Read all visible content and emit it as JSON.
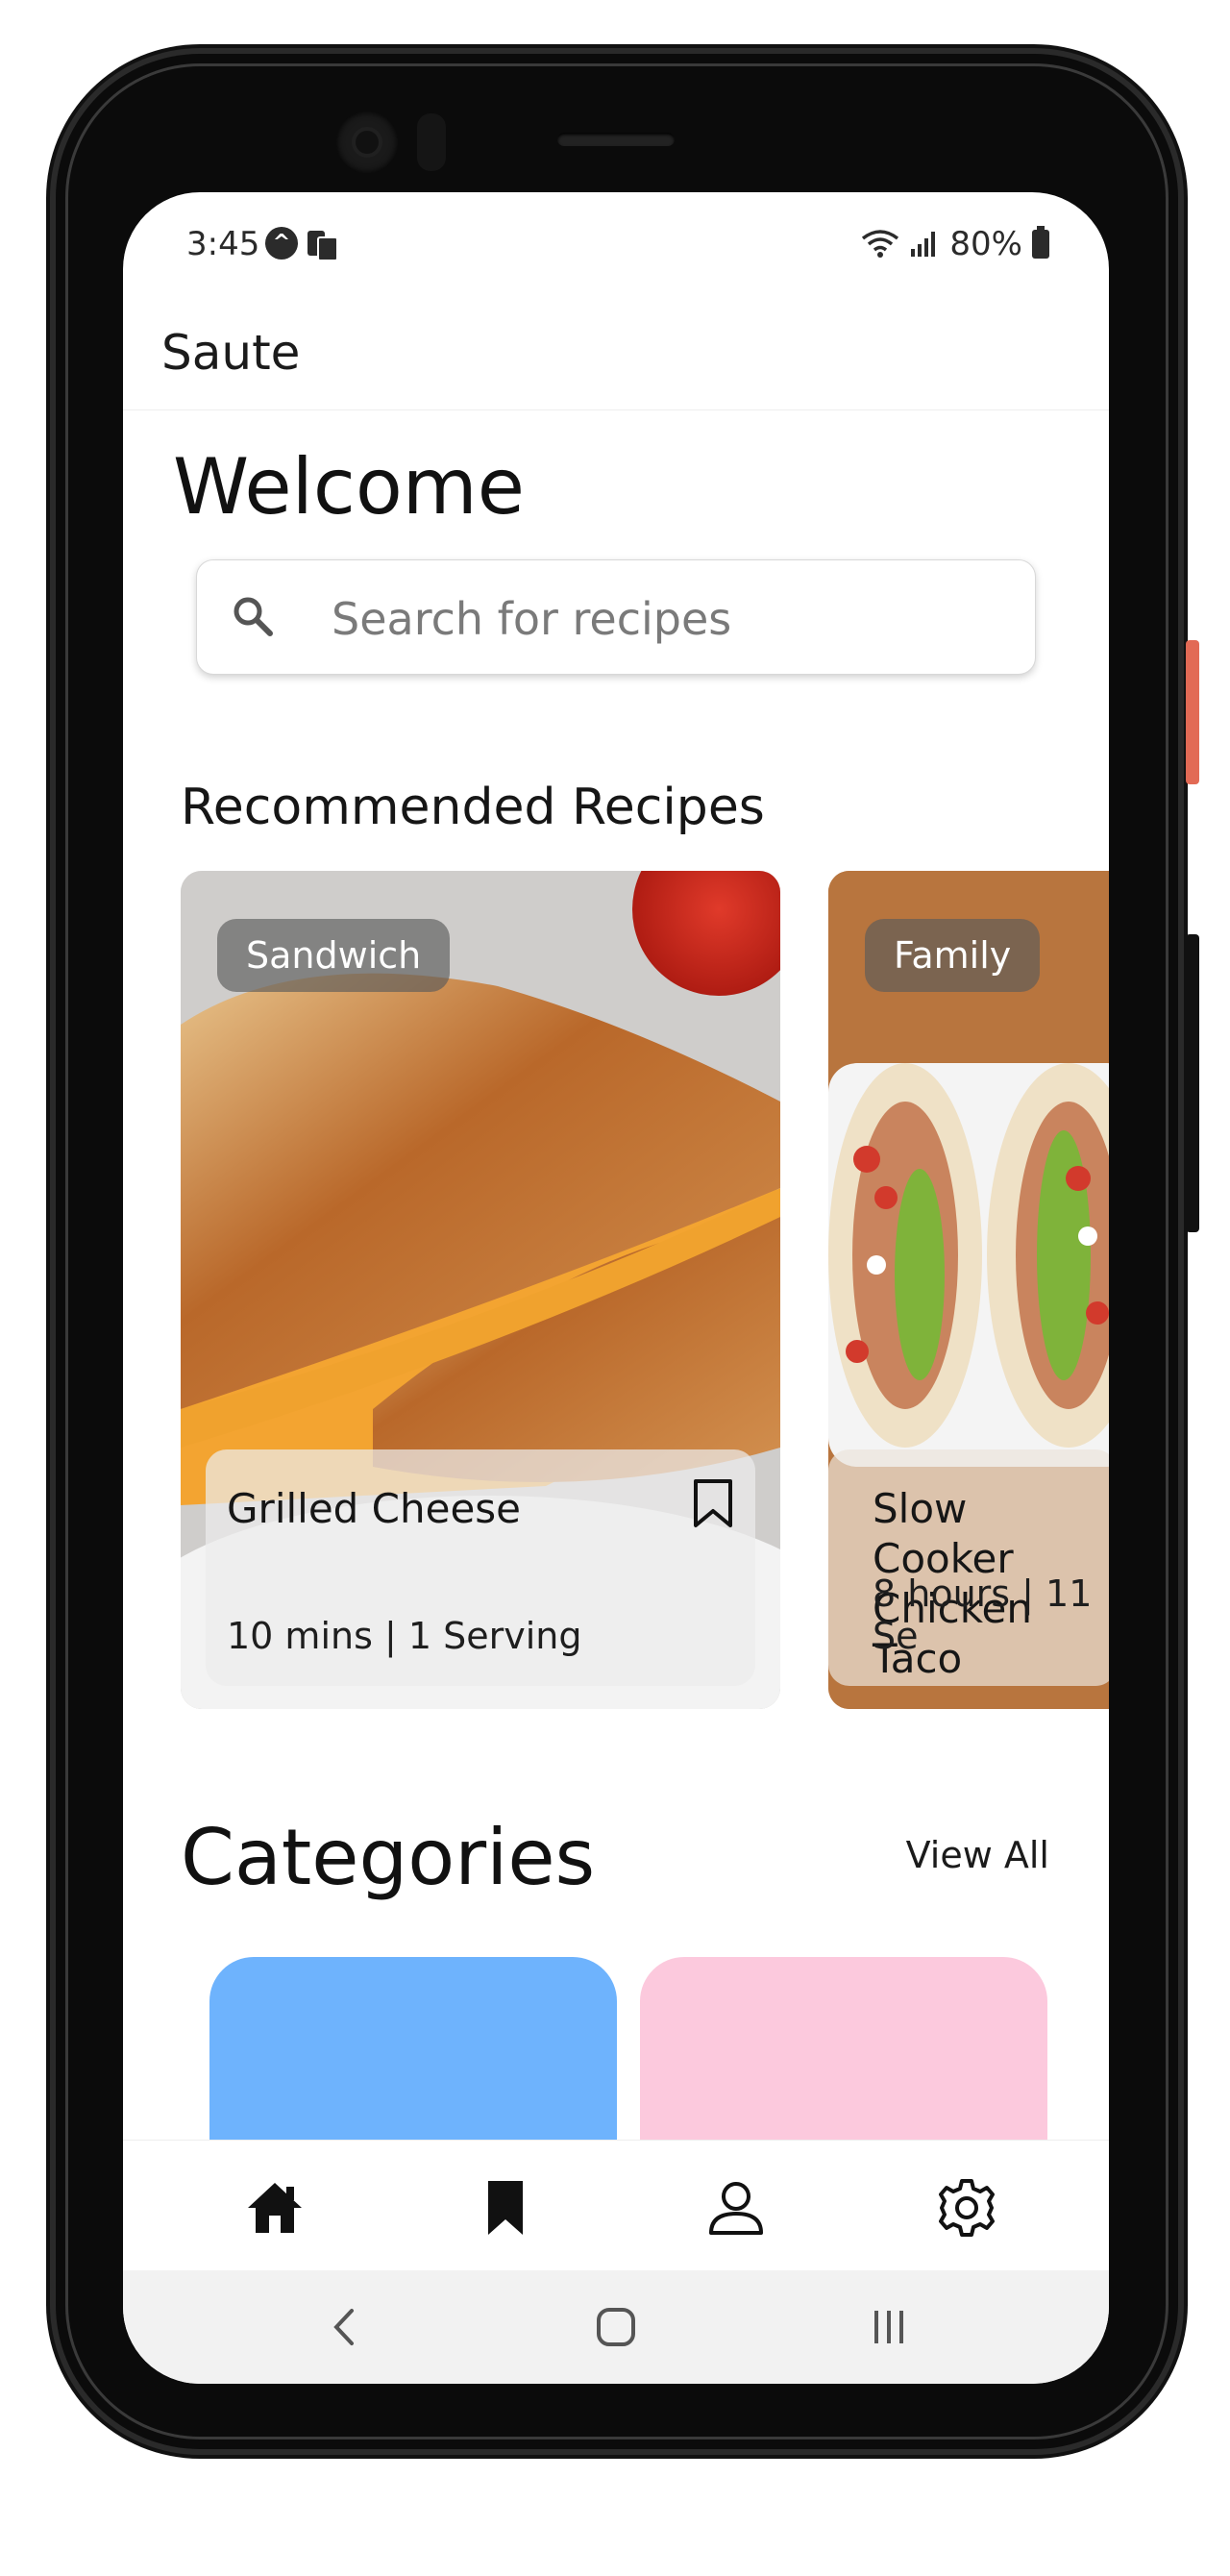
{
  "status_bar": {
    "time": "3:45",
    "notification_icons": [
      "accessibility-icon",
      "clipboard-icon"
    ],
    "battery": "80%"
  },
  "app_bar": {
    "title": "Saute"
  },
  "header": {
    "welcome": "Welcome"
  },
  "search": {
    "placeholder": "Search for recipes"
  },
  "recommended": {
    "title": "Recommended Recipes",
    "cards": [
      {
        "tag": "Sandwich",
        "name": "Grilled Cheese",
        "meta": "10 mins | 1 Serving"
      },
      {
        "tag": "Family",
        "name": "Slow Cooker Chicken Taco",
        "name_line1": "Slow Cooker",
        "name_line2": "Chicken Taco",
        "meta": "8 hours | 11 Se"
      }
    ]
  },
  "categories": {
    "title": "Categories",
    "view_all": "View All",
    "tile_colors": [
      "#6eb3fd",
      "#fcc9dd"
    ]
  },
  "bottom_nav": {
    "items": [
      "home-icon",
      "bookmark-icon",
      "profile-icon",
      "settings-icon"
    ]
  },
  "system_nav": {
    "items": [
      "back-icon",
      "home-button-icon",
      "recents-icon"
    ]
  }
}
